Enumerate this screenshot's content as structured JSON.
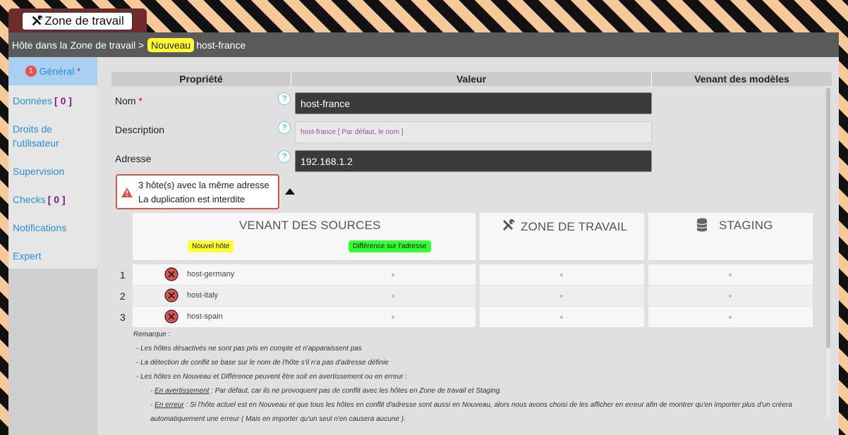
{
  "workspace": {
    "title": "Zone de travail",
    "icon": "tools-icon"
  },
  "breadcrumb": {
    "prefix": "Hôte dans la Zone de travail >",
    "badge": "Nouveau",
    "host": "host-france"
  },
  "sidebar": {
    "items": [
      {
        "label": "Général",
        "count": "1",
        "required": "*",
        "active": true
      },
      {
        "label": "Données",
        "bracket": "[ 0 ]"
      },
      {
        "label": "Droits de",
        "label2": "l'utilisateur"
      },
      {
        "label": "Supervision"
      },
      {
        "label": "Checks",
        "bracket": "[ 0 ]"
      },
      {
        "label": "Notifications"
      },
      {
        "label": "Expert"
      }
    ]
  },
  "table": {
    "headers": [
      "Propriété",
      "Valeur",
      "Venant des modèles"
    ],
    "rows": [
      {
        "label": "Nom",
        "required": "*",
        "value": "host-france"
      },
      {
        "label": "Description",
        "placeholder": "host-france [ Par défaut, le nom ]"
      },
      {
        "label": "Adresse",
        "value": "192.168.1.2"
      }
    ]
  },
  "warning": {
    "line1": "3 hôte(s) avec la même adresse",
    "line2": "La duplication est interdite"
  },
  "conflict": {
    "sources_title": "VENANT DES SOURCES",
    "workspace_title": "ZONE DE TRAVAIL",
    "staging_title": "STAGING",
    "tag_new": "Nouvel hôte",
    "tag_diff": "Différence sur l'adresse",
    "colors": {
      "tag_new": "#ffff33",
      "tag_diff": "#33ff33",
      "error": "#d9534f"
    },
    "rows": [
      {
        "num": "1",
        "host": "host-germany"
      },
      {
        "num": "2",
        "host": "host-italy"
      },
      {
        "num": "3",
        "host": "host-spain"
      }
    ]
  },
  "notes": {
    "title": "Remarque :",
    "l1": "- Les hôtes désactivés ne sont pas pris en compte et n'apparaissent pas",
    "l2": "- La détection de conflit se base sur le nom de l'hôte s'il n'a pas d'adresse définie",
    "l3": "- Les hôtes en Nouveau et Différence peuvent être soit en avertissement ou en erreur :",
    "l4_term": "En avertissement",
    "l4_text": " : Par défaut, car ils ne provoquent pas de conflit avec les hôtes en Zone de travail et Staging.",
    "l5_term": "En erreur",
    "l5_text": " : Si l'hôte actuel est en Nouveau et que tous les hôtes en conflit d'adresse sont aussi en Nouveau, alors nous avons choisi de les afficher en erreur afin de montrer qu'en importer plus d'un créera",
    "l6": "automatiquement une erreur ( Mais en importer qu'un seul n'en causera aucune )."
  }
}
